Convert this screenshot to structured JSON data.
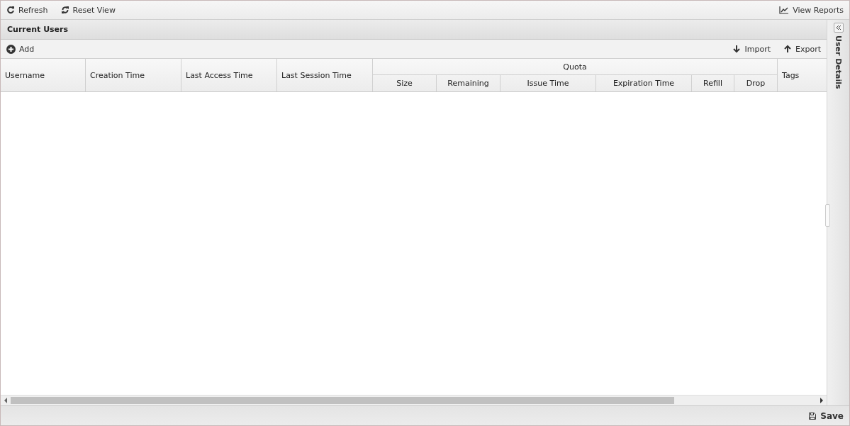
{
  "toolbar": {
    "left": [
      {
        "label": "Refresh",
        "kind": "refresh"
      },
      {
        "label": "Reset View",
        "kind": "reset"
      }
    ],
    "right": [
      {
        "label": "View Reports",
        "kind": "chart"
      }
    ]
  },
  "panel": {
    "title": "Current Users",
    "actions_left": [
      {
        "label": "Add",
        "kind": "add"
      }
    ],
    "actions_right": [
      {
        "label": "Import",
        "kind": "down"
      },
      {
        "label": "Export",
        "kind": "up"
      }
    ],
    "columns": [
      {
        "label": "Username"
      },
      {
        "label": "Creation Time"
      },
      {
        "label": "Last Access Time"
      },
      {
        "label": "Last Session Time"
      },
      {
        "label": "Quota",
        "children": [
          {
            "label": "Size"
          },
          {
            "label": "Remaining"
          },
          {
            "label": "Issue Time"
          },
          {
            "label": "Expiration Time"
          },
          {
            "label": "Refill"
          },
          {
            "label": "Drop"
          }
        ]
      },
      {
        "label": "Tags"
      }
    ]
  },
  "sidebar": {
    "title": "User Details"
  },
  "footer": {
    "buttons": [
      {
        "label": "Save",
        "kind": "save"
      }
    ]
  }
}
